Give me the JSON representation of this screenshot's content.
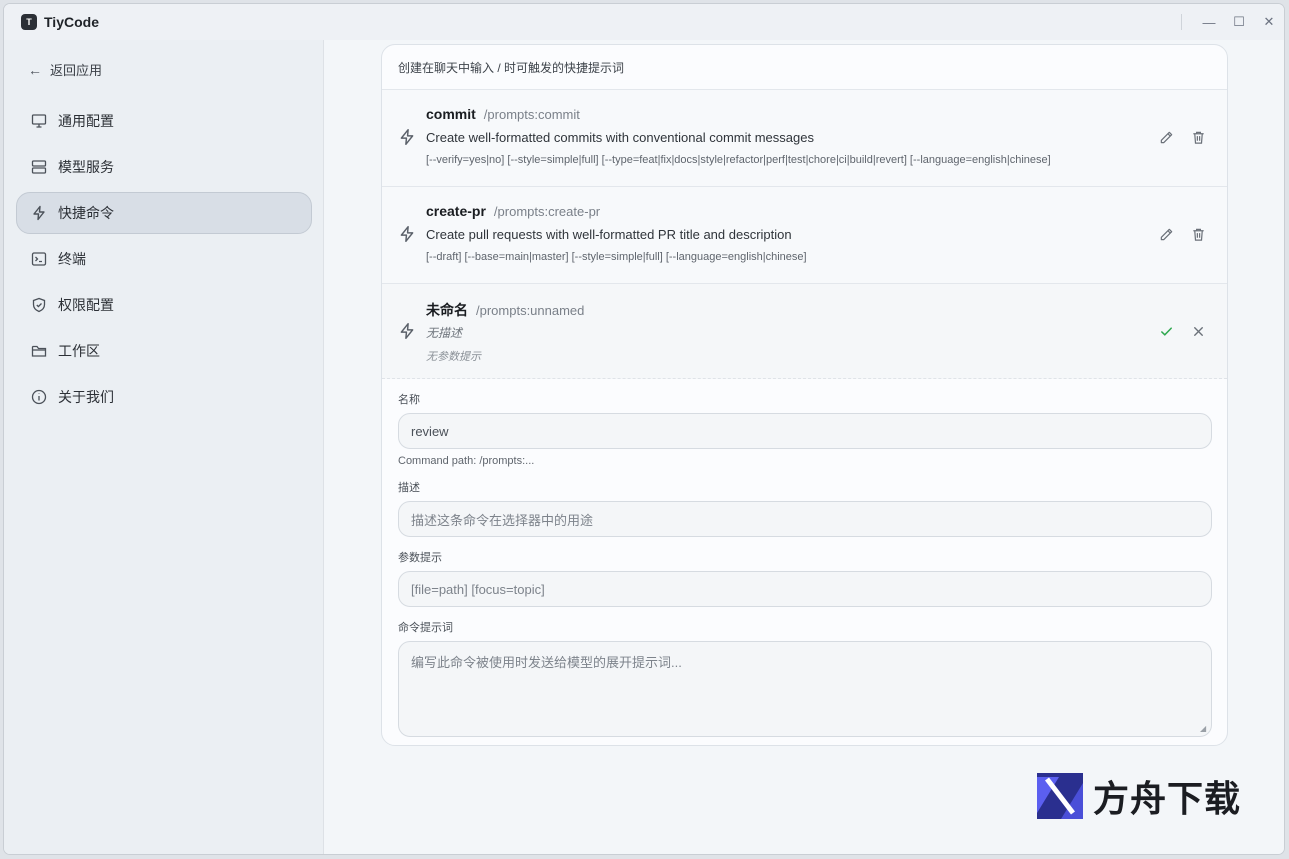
{
  "app": {
    "title": "TiyCode",
    "logo_glyph": "T"
  },
  "window_controls": {
    "minimize": "—",
    "maximize": "☐",
    "close": "✕"
  },
  "sidebar": {
    "back_label": "返回应用",
    "items": [
      {
        "label": "通用配置",
        "icon": "monitor-icon",
        "active": false
      },
      {
        "label": "模型服务",
        "icon": "server-icon",
        "active": false
      },
      {
        "label": "快捷命令",
        "icon": "bolt-icon",
        "active": true
      },
      {
        "label": "终端",
        "icon": "terminal-icon",
        "active": false
      },
      {
        "label": "权限配置",
        "icon": "shield-icon",
        "active": false
      },
      {
        "label": "工作区",
        "icon": "folder-icon",
        "active": false
      },
      {
        "label": "关于我们",
        "icon": "info-icon",
        "active": false
      }
    ]
  },
  "card": {
    "header": "创建在聊天中输入 / 时可触发的快捷提示词",
    "commands": [
      {
        "name": "commit",
        "path": "/prompts:commit",
        "description": "Create well-formatted commits with conventional commit messages",
        "args": "[--verify=yes|no] [--style=simple|full] [--type=feat|fix|docs|style|refactor|perf|test|chore|ci|build|revert] [--language=english|chinese]"
      },
      {
        "name": "create-pr",
        "path": "/prompts:create-pr",
        "description": "Create pull requests with well-formatted PR title and description",
        "args": "[--draft] [--base=main|master] [--style=simple|full] [--language=english|chinese]"
      },
      {
        "name": "未命名",
        "path": "/prompts:unnamed",
        "description": "无描述",
        "args": "无参数提示"
      }
    ],
    "form": {
      "name_label": "名称",
      "name_value": "review",
      "path_hint": "Command path: /prompts:...",
      "desc_label": "描述",
      "desc_placeholder": "描述这条命令在选择器中的用途",
      "args_label": "参数提示",
      "args_placeholder": "[file=path] [focus=topic]",
      "prompt_label": "命令提示词",
      "prompt_placeholder": "编写此命令被使用时发送给模型的展开提示词..."
    }
  },
  "watermark": {
    "text": "方舟下载"
  }
}
